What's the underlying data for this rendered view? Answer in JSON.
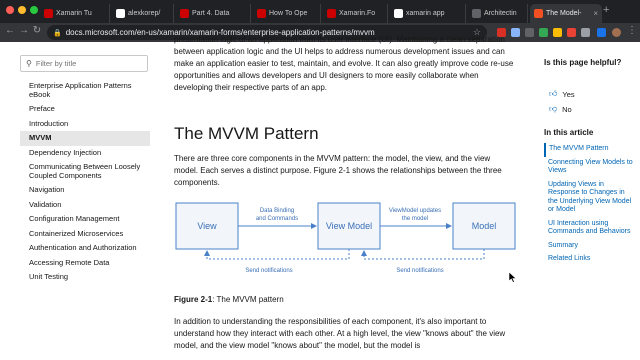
{
  "browser": {
    "tabs": [
      {
        "label": "Xamarin Tu",
        "favicon_color": "#cc0000"
      },
      {
        "label": "alexkorep/",
        "favicon_color": "#ffffff"
      },
      {
        "label": "Part 4. Data",
        "favicon_color": "#cc0000"
      },
      {
        "label": "How To Ope",
        "favicon_color": "#cc0000"
      },
      {
        "label": "Xamarin.Fo",
        "favicon_color": "#cc0000"
      },
      {
        "label": "xamarin app",
        "favicon_color": "#ffffff"
      },
      {
        "label": "Architectin",
        "favicon_color": "#5f6368"
      },
      {
        "label": "The Model-",
        "favicon_color": "#f25022",
        "active": true
      }
    ],
    "url": "docs.microsoft.com/en-us/xamarin/xamarin-forms/enterprise-application-patterns/mvvm"
  },
  "left_nav": {
    "filter_placeholder": "Filter by title",
    "items": [
      "Enterprise Application Patterns eBook",
      "Preface",
      "Introduction",
      "MVVM",
      "Dependency Injection",
      "Communicating Between Loosely Coupled Components",
      "Navigation",
      "Validation",
      "Configuration Management",
      "Containerized Microservices",
      "Authentication and Authorization",
      "Accessing Remote Data",
      "Unit Testing"
    ],
    "active_index": 3
  },
  "article": {
    "intro": "presentation logic of an application from its user interface (UI). Maintaining a clean separation between application logic and the UI helps to address numerous development issues and can make an application easier to test, maintain, and evolve. It can also greatly improve code re-use opportunities and allows developers and UI designers to more easily collaborate when developing their respective parts of an app.",
    "heading": "The MVVM Pattern",
    "body": "There are three core components in the MVVM pattern: the model, the view, and the view model. Each serves a distinct purpose. Figure 2-1 shows the relationships between the three components.",
    "diagram": {
      "view": "View",
      "view_model": "View Model",
      "model": "Model",
      "data_binding_1": "Data Binding",
      "data_binding_2": "and Commands",
      "vm_updates_1": "ViewModel updates",
      "vm_updates_2": "the model",
      "notif_left": "Send notifications",
      "notif_right": "Send notifications"
    },
    "caption_bold": "Figure 2-1",
    "caption_text": ": The MVVM pattern",
    "body2": "In addition to understanding the responsibilities of each component, it's also important to understand how they interact with each other. At a high level, the view \"knows about\" the view model, and the view model \"knows about\" the model, but the model is"
  },
  "right_col": {
    "helpful": "Is this page helpful?",
    "yes": "Yes",
    "no": "No",
    "toc_title": "In this article",
    "toc": [
      "The MVVM Pattern",
      "Connecting View Models to Views",
      "Updating Views in Response to Changes in the Underlying View Model or Model",
      "UI Interaction using Commands and Behaviors",
      "Summary",
      "Related Links"
    ],
    "toc_active_index": 0
  },
  "colors": {
    "link": "#0065b3",
    "diagram_box": "#4a80c8",
    "diagram_fill": "#f2f6fb"
  }
}
